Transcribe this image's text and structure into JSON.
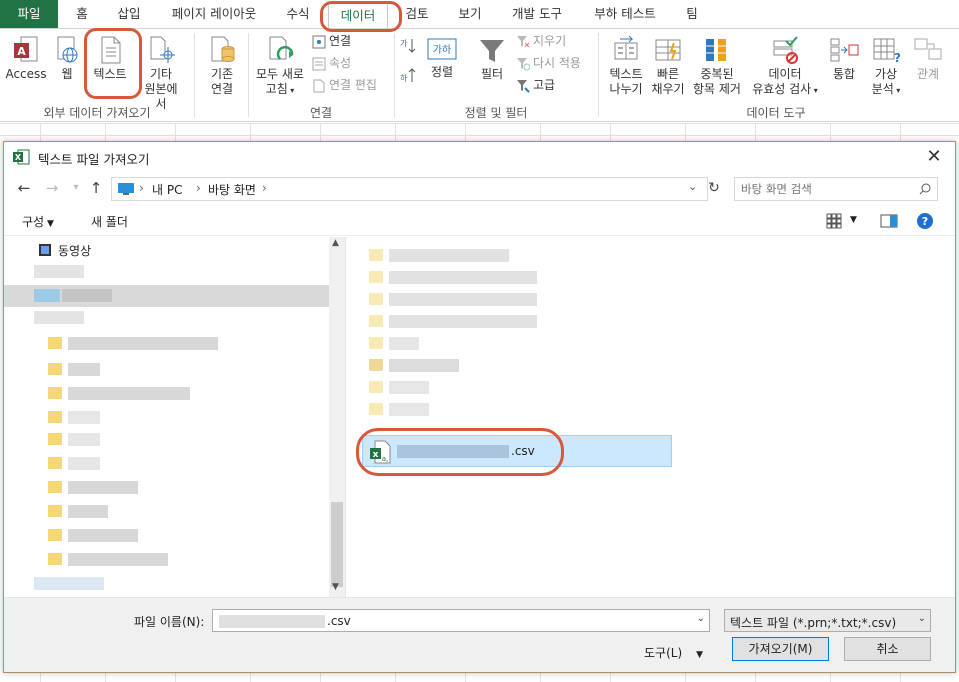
{
  "ribbon_tabs": [
    {
      "label": "파일"
    },
    {
      "label": "홈"
    },
    {
      "label": "삽입"
    },
    {
      "label": "페이지 레이아웃"
    },
    {
      "label": "수식"
    },
    {
      "label": "데이터"
    },
    {
      "label": "검토"
    },
    {
      "label": "보기"
    },
    {
      "label": "개발 도구"
    },
    {
      "label": "부하 테스트"
    },
    {
      "label": "팀"
    }
  ],
  "ribbon": {
    "external": {
      "access": "Access",
      "web": "웹",
      "text": "텍스트",
      "other_1": "기타",
      "other_2": "원본에서",
      "group": "외부 데이터 가져오기"
    },
    "existing": {
      "line1": "기존",
      "line2": "연결"
    },
    "connections": {
      "refresh_1": "모두 새로",
      "refresh_2": "고침",
      "conn": "연결",
      "props": "속성",
      "edit_links": "연결 편집",
      "group": "연결"
    },
    "sort": {
      "sort": "정렬",
      "filter": "필터",
      "clear": "지우기",
      "reapply": "다시 적용",
      "advanced": "고급",
      "group": "정렬 및 필터"
    },
    "tools": {
      "text_cols_1": "텍스트",
      "text_cols_2": "나누기",
      "flash_1": "빠른",
      "flash_2": "채우기",
      "dup_1": "중복된",
      "dup_2": "항목 제거",
      "valid_1": "데이터",
      "valid_2": "유효성 검사",
      "consolidate": "통합",
      "whatif_1": "가상",
      "whatif_2": "분석",
      "relations": "관계",
      "group": "데이터 도구"
    }
  },
  "dialog": {
    "title": "텍스트 파일 가져오기",
    "breadcrumb": [
      "내 PC",
      "바탕 화면"
    ],
    "search_placeholder": "바탕 화면 검색",
    "organize": "구성",
    "new_folder": "새 폴더",
    "nav_first": "동영상",
    "selected_file_suffix": ".csv",
    "filename_label": "파일 이름(N):",
    "filename_suffix": ".csv",
    "filetype": "텍스트 파일 (*.prn;*.txt;*.csv)",
    "tools": "도구(L)",
    "open": "가져오기(M)",
    "cancel": "취소"
  },
  "colors": {
    "excel_green": "#217346",
    "annotation": "#d9583b",
    "selection": "#cce8ff"
  }
}
